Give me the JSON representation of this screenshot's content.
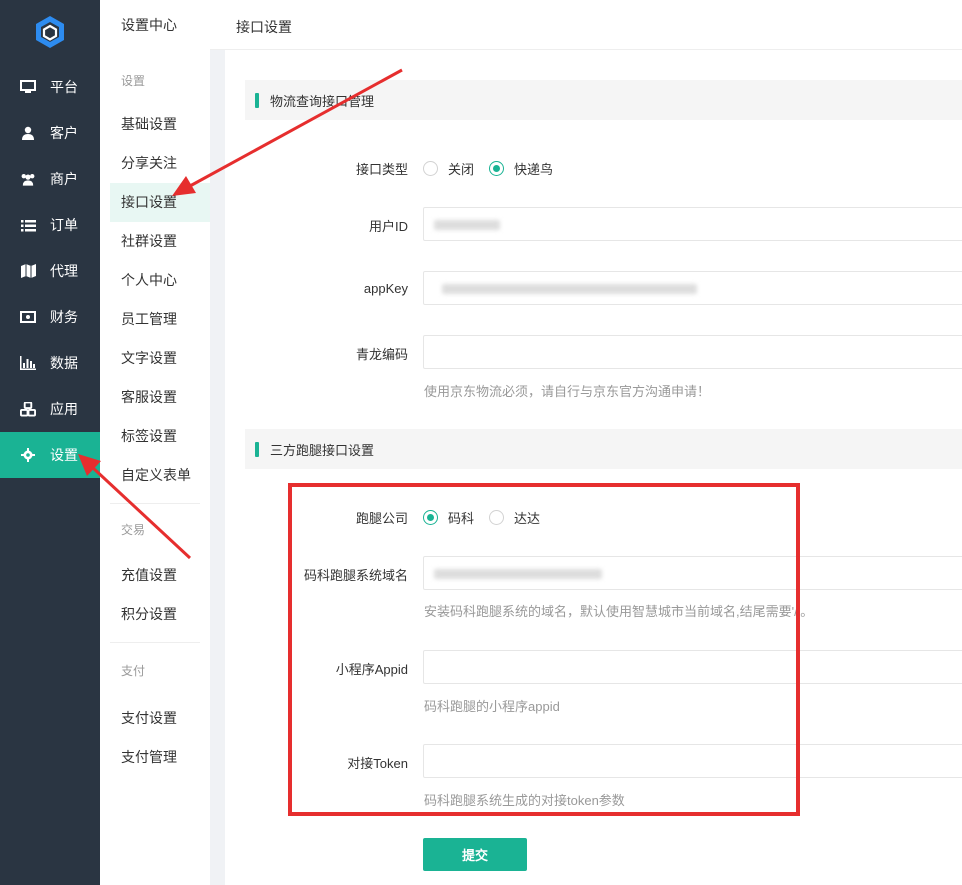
{
  "nav": {
    "items": [
      {
        "label": "平台",
        "icon": "monitor-icon"
      },
      {
        "label": "客户",
        "icon": "user-icon"
      },
      {
        "label": "商户",
        "icon": "users-icon"
      },
      {
        "label": "订单",
        "icon": "list-icon"
      },
      {
        "label": "代理",
        "icon": "map-icon"
      },
      {
        "label": "财务",
        "icon": "money-icon"
      },
      {
        "label": "数据",
        "icon": "bar-chart-icon"
      },
      {
        "label": "应用",
        "icon": "cubes-icon"
      },
      {
        "label": "设置",
        "icon": "gear-icon",
        "active": true
      }
    ]
  },
  "sub_nav": {
    "title": "设置中心",
    "groups": {
      "settings": "设置",
      "trade": "交易",
      "payment": "支付"
    },
    "items_settings": [
      "基础设置",
      "分享关注",
      "接口设置",
      "社群设置",
      "个人中心",
      "员工管理",
      "文字设置",
      "客服设置",
      "标签设置",
      "自定义表单"
    ],
    "items_trade": [
      "充值设置",
      "积分设置"
    ],
    "items_payment": [
      "支付设置",
      "支付管理"
    ]
  },
  "header": {
    "title": "接口设置"
  },
  "section1": {
    "title": "物流查询接口管理",
    "interface_type_label": "接口类型",
    "option_off": "关闭",
    "option_kdn": "快递鸟",
    "user_id_label": "用户ID",
    "appkey_label": "appKey",
    "qinglong_label": "青龙编码",
    "qinglong_help": "使用京东物流必须，请自行与京东官方沟通申请！"
  },
  "section2": {
    "title": "三方跑腿接口设置",
    "company_label": "跑腿公司",
    "option_make": "码科",
    "option_dada": "达达",
    "domain_label": "码科跑腿系统域名",
    "domain_help": "安装码科跑腿系统的域名，默认使用智慧城市当前域名,结尾需要'/'。",
    "appid_label": "小程序Appid",
    "appid_help": "码科跑腿的小程序appid",
    "token_label": "对接Token",
    "token_help": "码科跑腿系统生成的对接token参数"
  },
  "submit_label": "提交",
  "colors": {
    "accent": "#1ab394",
    "sidebar": "#2a3542",
    "annotation": "#e62e2e"
  }
}
